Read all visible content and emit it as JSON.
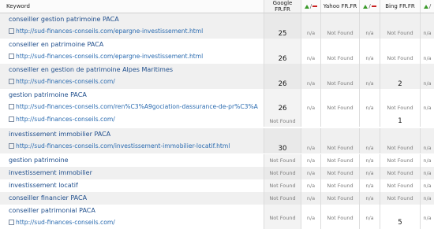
{
  "header": {
    "keyword": "Keyword",
    "google_line1": "Google",
    "google_line2": "FR.FR",
    "trend_slash": "/",
    "yahoo": "Yahoo FR.FR",
    "bing": "Bing FR.FR"
  },
  "rows": [
    {
      "keyword": "conseiller gestion patrimoine PACA",
      "url": "http://sud-finances-conseils.com/epargne-investissement.html",
      "google": "25",
      "google_trend": "n/a",
      "yahoo": "Not Found",
      "yahoo_trend": "n/a",
      "bing": "Not Found",
      "bing_trend": "n/a"
    },
    {
      "keyword": "conseiller en patrimoine PACA",
      "url": "http://sud-finances-conseils.com/epargne-investissement.html",
      "google": "26",
      "google_trend": "n/a",
      "yahoo": "Not Found",
      "yahoo_trend": "n/a",
      "bing": "Not Found",
      "bing_trend": "n/a"
    },
    {
      "keyword": "conseiller en gestion de patrimoine Alpes Maritimes",
      "url": "http://sud-finances-conseils.com/",
      "google": "26",
      "google_trend": "n/a",
      "yahoo": "Not Found",
      "yahoo_trend": "n/a",
      "bing": "2",
      "bing_trend": "n/a"
    },
    {
      "keyword": "gestion patrimoine PACA",
      "url": "http://sud-finances-conseils.com/ren%C3%A9gociation-dassurance-de-pr%C3%A",
      "url2": "http://sud-finances-conseils.com/",
      "google": "26",
      "google2": "Not Found",
      "google_trend": "n/a",
      "yahoo": "Not Found",
      "yahoo_trend": "n/a",
      "bing": "Not Found",
      "bing2": "1",
      "bing_trend": "n/a"
    },
    {
      "keyword": "investissement immobilier PACA",
      "url": "http://sud-finances-conseils.com/investissement-immobilier-locatif.html",
      "google": "30",
      "google_trend": "n/a",
      "yahoo": "Not Found",
      "yahoo_trend": "n/a",
      "bing": "Not Found",
      "bing_trend": "n/a"
    },
    {
      "keyword": "gestion patrimoine",
      "google": "Not Found",
      "google_trend": "n/a",
      "yahoo": "Not Found",
      "yahoo_trend": "n/a",
      "bing": "Not Found",
      "bing_trend": "n/a"
    },
    {
      "keyword": "investissement immobilier",
      "google": "Not Found",
      "google_trend": "n/a",
      "yahoo": "Not Found",
      "yahoo_trend": "n/a",
      "bing": "Not Found",
      "bing_trend": "n/a"
    },
    {
      "keyword": "investissement locatif",
      "google": "Not Found",
      "google_trend": "n/a",
      "yahoo": "Not Found",
      "yahoo_trend": "n/a",
      "bing": "Not Found",
      "bing_trend": "n/a"
    },
    {
      "keyword": "conseiller financier PACA",
      "google": "Not Found",
      "google_trend": "n/a",
      "yahoo": "Not Found",
      "yahoo_trend": "n/a",
      "bing": "Not Found",
      "bing_trend": "n/a"
    },
    {
      "keyword": "conseiller patrimonial PACA",
      "url": "http://sud-finances-conseils.com/",
      "google": "Not Found",
      "google_trend": "n/a",
      "yahoo": "Not Found",
      "yahoo_trend": "n/a",
      "bing": "5",
      "bing_trend": "n/a"
    }
  ]
}
